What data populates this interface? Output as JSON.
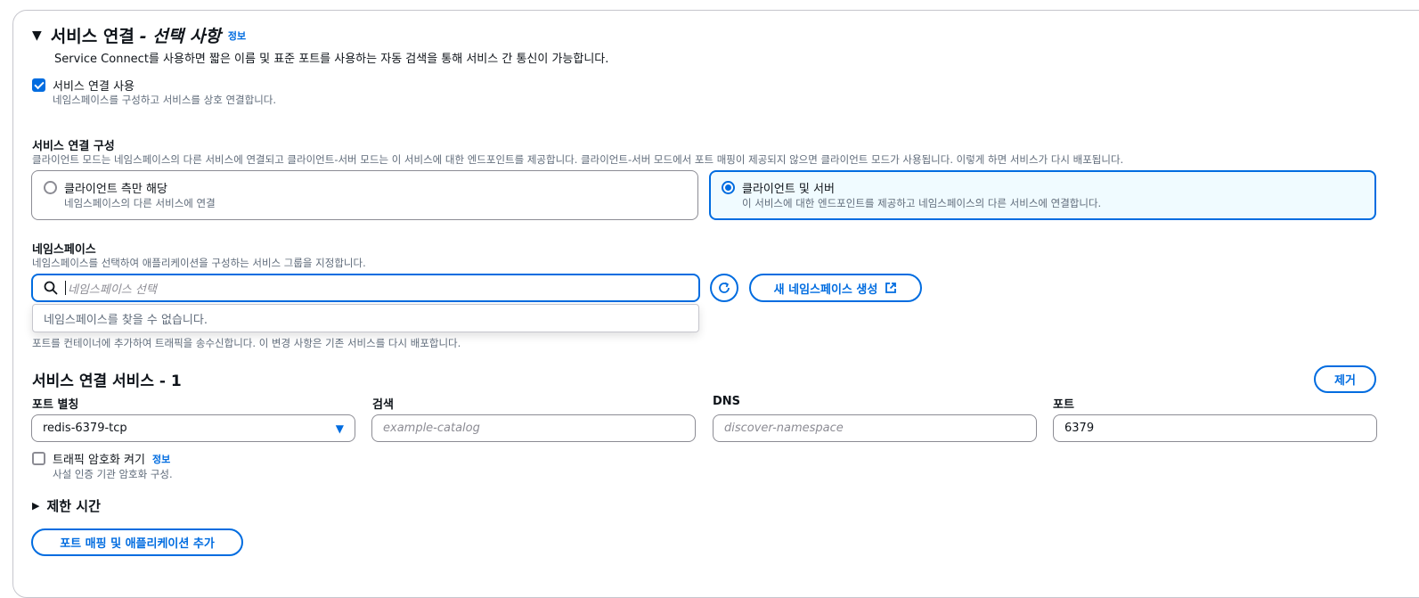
{
  "section": {
    "title": "서비스 연결",
    "title_optional": "- 선택 사항",
    "info_link": "정보",
    "description": "Service Connect를 사용하면 짧은 이름 및 표준 포트를 사용하는 자동 검색을 통해 서비스 간 통신이 가능합니다."
  },
  "use_service_connect": {
    "label": "서비스 연결 사용",
    "description": "네임스페이스를 구성하고 서비스를 상호 연결합니다.",
    "checked": true
  },
  "config": {
    "label": "서비스 연결 구성",
    "description": "클라이언트 모드는 네임스페이스의 다른 서비스에 연결되고 클라이언트-서버 모드는 이 서비스에 대한 엔드포인트를 제공합니다. 클라이언트-서버 모드에서 포트 매핑이 제공되지 않으면 클라이언트 모드가 사용됩니다. 이렇게 하면 서비스가 다시 배포됩니다.",
    "options": [
      {
        "label": "클라이언트 측만 해당",
        "description": "네임스페이스의 다른 서비스에 연결",
        "selected": false
      },
      {
        "label": "클라이언트 및 서버",
        "description": "이 서비스에 대한 엔드포인트를 제공하고 네임스페이스의 다른 서비스에 연결합니다.",
        "selected": true
      }
    ]
  },
  "namespace": {
    "label": "네임스페이스",
    "description": "네임스페이스를 선택하여 애플리케이션을 구성하는 서비스 그룹을 지정합니다.",
    "placeholder": "네임스페이스 선택",
    "empty_message": "네임스페이스를 찾을 수 없습니다.",
    "create_button": "새 네임스페이스 생성"
  },
  "port_mapping_note": "포트를 컨테이너에 추가하여 트래픽을 송수신합니다. 이 변경 사항은 기존 서비스를 다시 배포합니다.",
  "service": {
    "title": "서비스 연결 서비스 - 1",
    "remove_button": "제거",
    "fields": {
      "port_alias": {
        "label": "포트 별칭",
        "value": "redis-6379-tcp"
      },
      "discovery": {
        "label": "검색",
        "placeholder": "example-catalog"
      },
      "dns": {
        "label": "DNS",
        "placeholder": "discover-namespace"
      },
      "port": {
        "label": "포트",
        "value": "6379"
      }
    },
    "tls": {
      "label": "트래픽 암호화 켜기",
      "info_link": "정보",
      "description": "사설 인증 기관 암호화 구성.",
      "checked": false
    },
    "timeout": {
      "label": "제한 시간"
    }
  },
  "add_button": "포트 매핑 및 애플리케이션 추가",
  "colors": {
    "accent": "#006ce0",
    "border": "#8c8c94",
    "selected_bg": "#f0fbff"
  }
}
